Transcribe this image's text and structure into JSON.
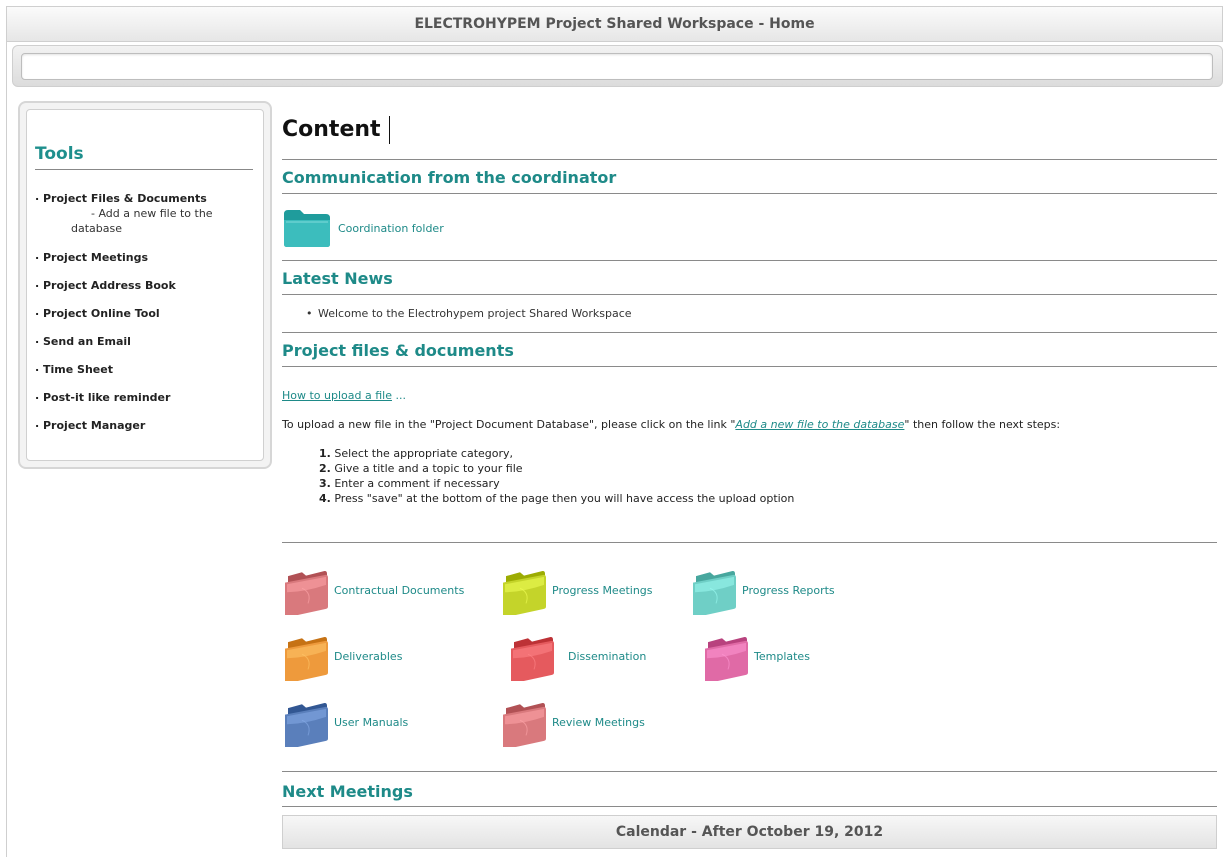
{
  "window": {
    "title": "ELECTROHYPEM Project Shared Workspace - Home"
  },
  "search": {
    "placeholder": ""
  },
  "sidebar": {
    "title": "Tools",
    "items": [
      {
        "label": "Project Files & Documents",
        "sub": [
          "- Add a new file to the",
          "database"
        ]
      },
      {
        "label": "Project Meetings"
      },
      {
        "label": "Project Address Book"
      },
      {
        "label": "Project Online Tool"
      },
      {
        "label": "Send an Email"
      },
      {
        "label": "Time Sheet"
      },
      {
        "label": "Post-it like reminder"
      },
      {
        "label": "Project Manager"
      }
    ]
  },
  "main": {
    "heading": "Content",
    "communication": {
      "title": "Communication from the coordinator",
      "folder_label": "Coordination folder"
    },
    "news": {
      "title": "Latest News",
      "items": [
        "Welcome to the Electrohypem project Shared Workspace"
      ]
    },
    "files": {
      "title": "Project files & documents",
      "howto_link": "How to upload a file",
      "howto_suffix": " ...",
      "upload_prefix": "To upload a new file in the \"Project Document Database\", please click on the link \"",
      "upload_link": "Add a new file to the database",
      "upload_suffix": "\"  then follow the next steps:",
      "steps": [
        {
          "num": "1.",
          "text": "Select the appropriate category,"
        },
        {
          "num": "2.",
          "text": "Give a title and a topic to your file"
        },
        {
          "num": "3.",
          "text": "Enter a comment if necessary"
        },
        {
          "num": "4.",
          "text": "Press \"save\" at the bottom of the page then you will have access the upload option"
        }
      ]
    },
    "folders": [
      {
        "label": "Contractual Documents",
        "color": "#d9797d"
      },
      {
        "label": "Progress Meetings",
        "color": "#c4d42a"
      },
      {
        "label": "Progress Reports",
        "color": "#6fcfc6"
      },
      {
        "label": "Deliverables",
        "color": "#ee9a3c"
      },
      {
        "label": "Dissemination",
        "color": "#e55a5e"
      },
      {
        "label": "Templates",
        "color": "#e06aa6"
      },
      {
        "label": "User Manuals",
        "color": "#5a7fbb"
      },
      {
        "label": "Review Meetings",
        "color": "#d9797d"
      }
    ],
    "next_meetings": {
      "title": "Next Meetings",
      "calendar": "Calendar - After October 19, 2012"
    }
  },
  "colors": {
    "accent": "#1e8a88",
    "coord_folder": "#2aa8a8"
  }
}
